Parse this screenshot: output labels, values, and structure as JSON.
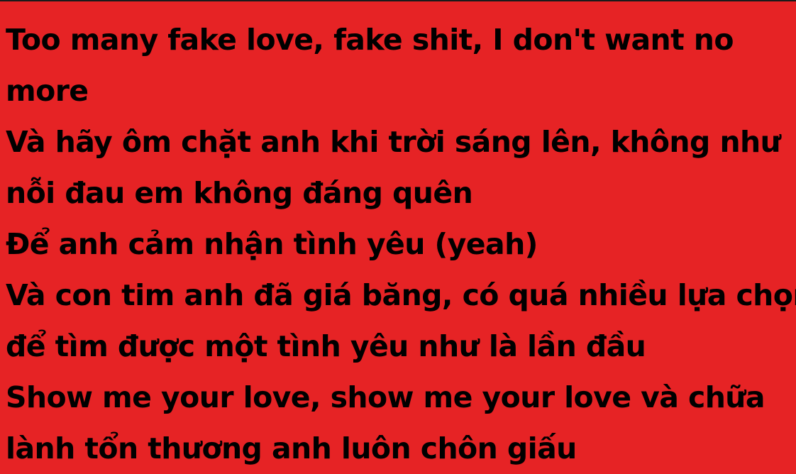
{
  "colors": {
    "background": "#e62325",
    "text": "#000000"
  },
  "lyrics": {
    "lines": [
      "Too many fake love, fake shit, I don't want no",
      "more",
      "Và hãy ôm chặt anh khi trời sáng lên, không như",
      "nỗi đau em không đáng quên",
      "Để anh cảm nhận tình yêu (yeah)",
      "Và con tim anh đã giá băng, có quá nhiều lựa chọn",
      "để tìm được một tình yêu như là lần đầu",
      "Show me your love, show me your love và chữa",
      "lành tổn thương anh luôn chôn giấu"
    ]
  }
}
